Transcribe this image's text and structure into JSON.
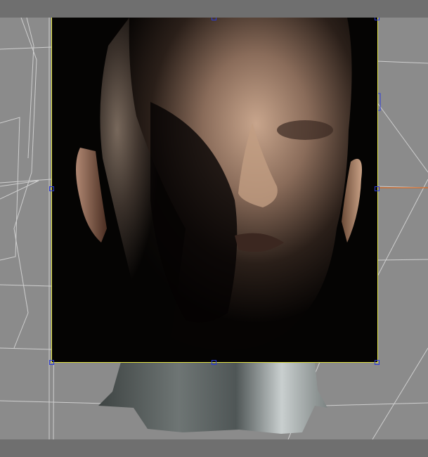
{
  "viewport": {
    "label": "",
    "background": "#8b8b8b",
    "frame_border_color": "#e8e84a",
    "handle_color": "#2b3bd8",
    "light_line_color": "#d8661f"
  },
  "render": {
    "subject_icon": "head-render-icon"
  },
  "icons": {
    "selection_handle": "square-handle-icon"
  }
}
